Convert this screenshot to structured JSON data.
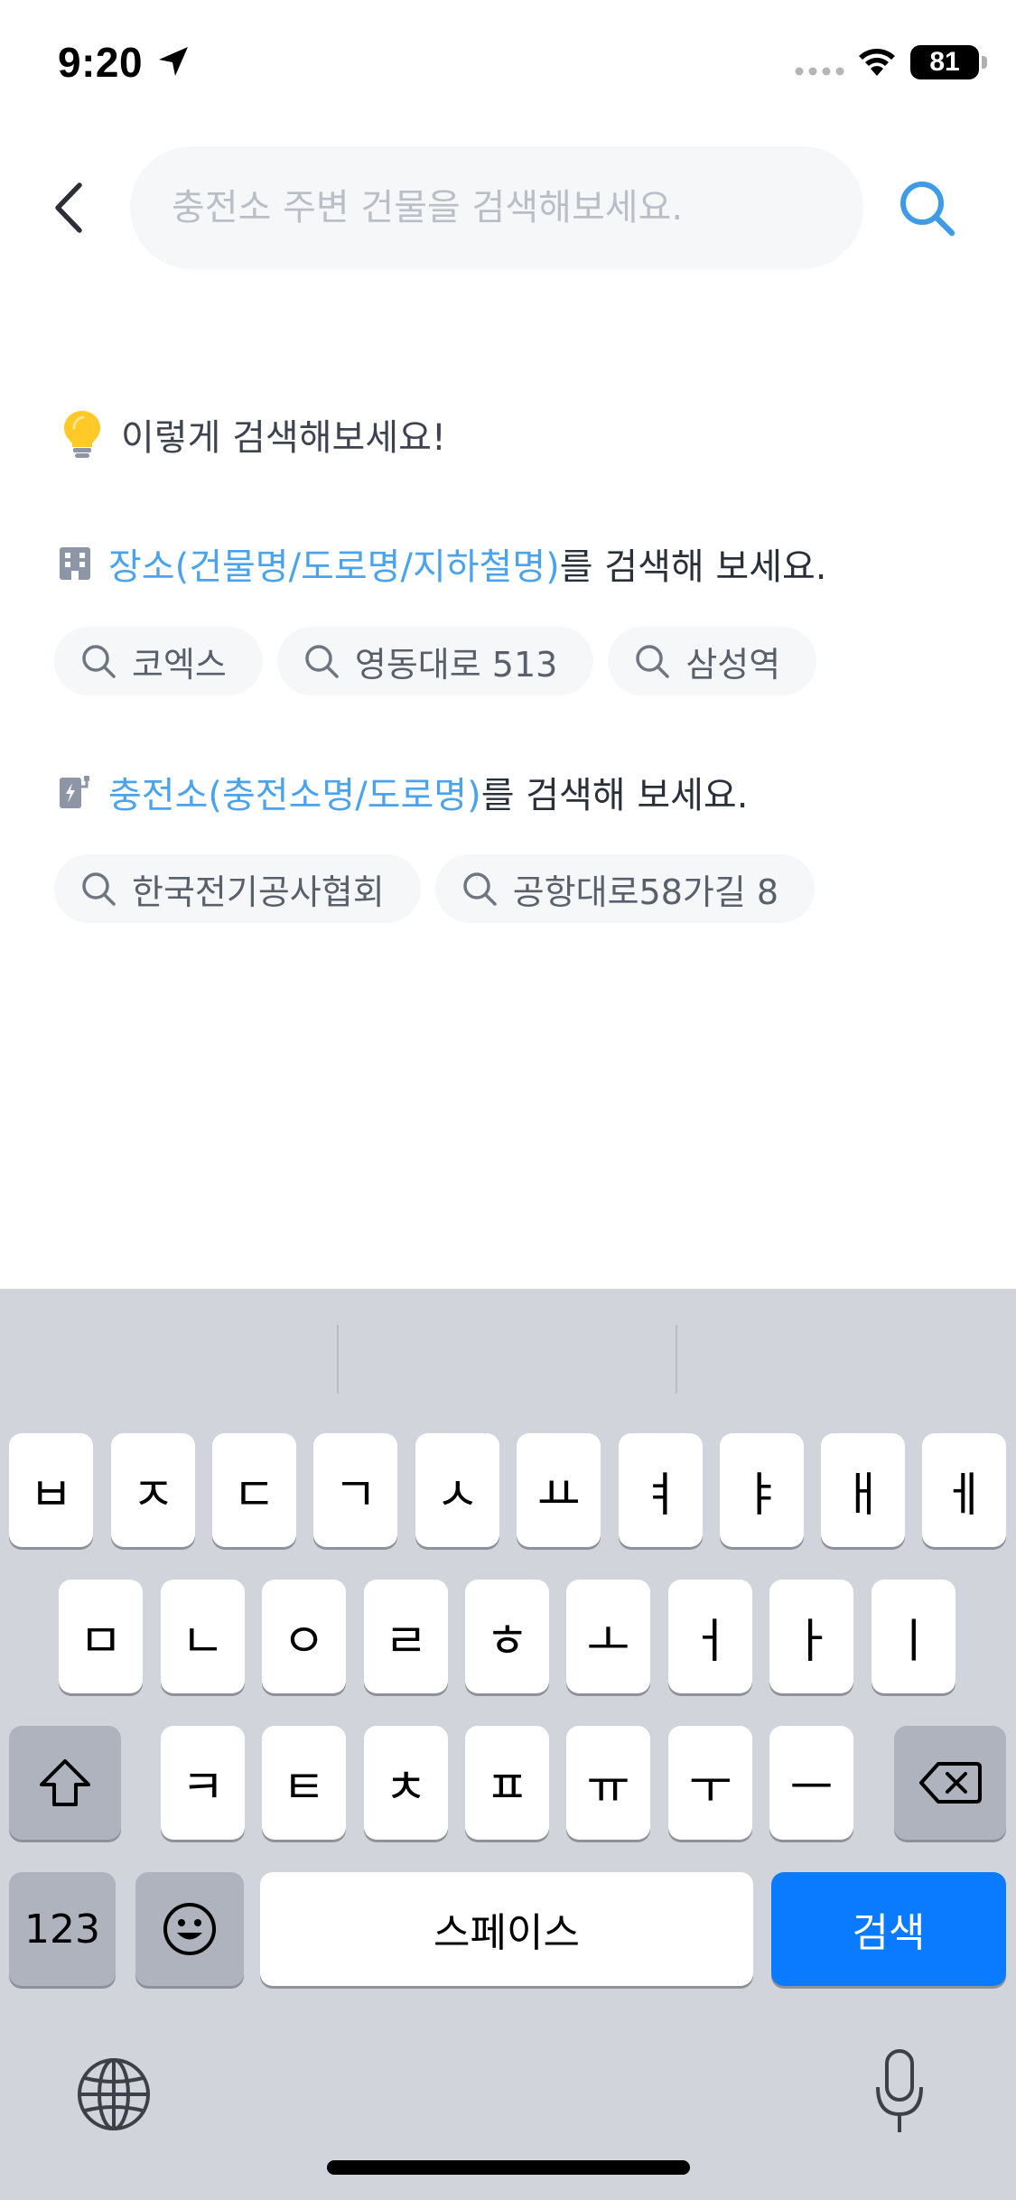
{
  "status_bar": {
    "time": "9:20",
    "battery": "81",
    "icons": [
      "location-arrow-icon",
      "cellular-signal-icon",
      "wifi-icon",
      "battery-icon"
    ]
  },
  "header": {
    "back_icon": "chevron-left-icon",
    "search_placeholder": "충전소 주변 건물을 검색해보세요.",
    "search_value": "",
    "search_icon": "search-icon",
    "accent_color": "#3f9be6"
  },
  "tips": {
    "title": "이렇게 검색해보세요!",
    "title_icon": "lightbulb-icon",
    "sections": [
      {
        "icon": "building-icon",
        "highlight": "장소(건물명/도로명/지하철명)",
        "suffix": "를 검색해 보세요.",
        "chips": [
          "코엑스",
          "영동대로 513",
          "삼성역"
        ]
      },
      {
        "icon": "ev-charger-icon",
        "highlight": "충전소(충전소명/도로명)",
        "suffix": "를 검색해 보세요.",
        "chips": [
          "한국전기공사협회",
          "공항대로58가길 8"
        ]
      }
    ],
    "highlight_color": "#4aa3ec"
  },
  "keyboard": {
    "row1": [
      "ㅂ",
      "ㅈ",
      "ㄷ",
      "ㄱ",
      "ㅅ",
      "ㅛ",
      "ㅕ",
      "ㅑ",
      "ㅐ",
      "ㅔ"
    ],
    "row2": [
      "ㅁ",
      "ㄴ",
      "ㅇ",
      "ㄹ",
      "ㅎ",
      "ㅗ",
      "ㅓ",
      "ㅏ",
      "ㅣ"
    ],
    "row3": [
      "ㅋ",
      "ㅌ",
      "ㅊ",
      "ㅍ",
      "ㅠ",
      "ㅜ",
      "ㅡ"
    ],
    "numbers_label": "123",
    "space_label": "스페이스",
    "search_label": "검색",
    "search_key_color": "#0a7bff",
    "icons": [
      "shift-icon",
      "backspace-icon",
      "emoji-icon",
      "globe-icon",
      "microphone-icon"
    ]
  }
}
